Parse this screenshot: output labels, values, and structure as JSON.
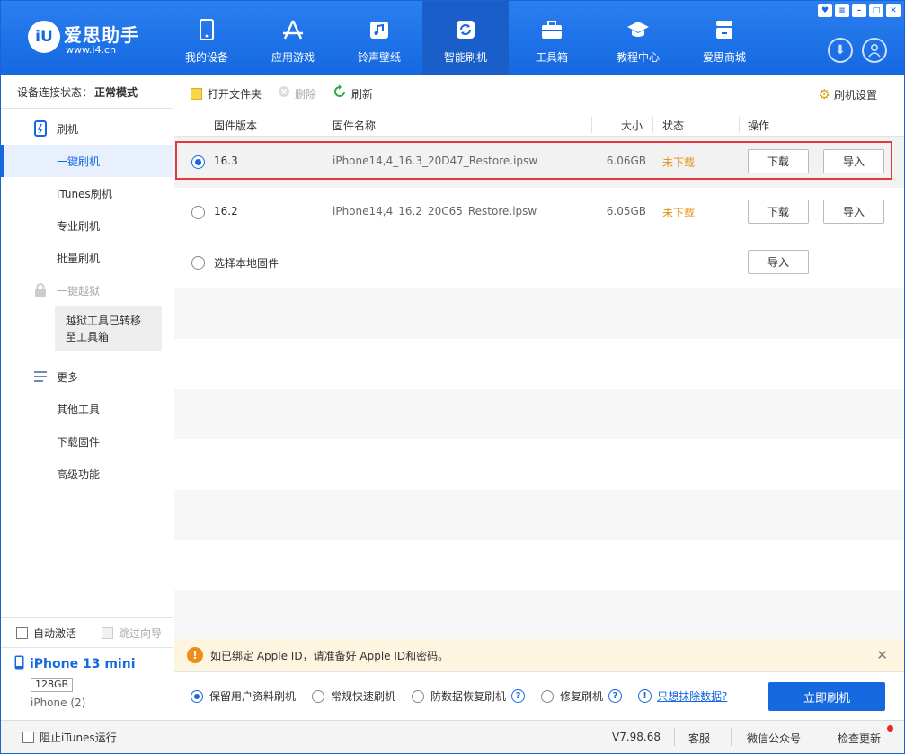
{
  "app": {
    "brand_name": "爱思助手",
    "brand_url": "www.i4.cn",
    "logo_text": "iU"
  },
  "nav": [
    {
      "label": "我的设备",
      "icon": "phone-icon"
    },
    {
      "label": "应用游戏",
      "icon": "app-store-icon"
    },
    {
      "label": "铃声壁纸",
      "icon": "music-icon"
    },
    {
      "label": "智能刷机",
      "icon": "refresh-icon",
      "active": true
    },
    {
      "label": "工具箱",
      "icon": "toolbox-icon"
    },
    {
      "label": "教程中心",
      "icon": "graduation-cap-icon"
    },
    {
      "label": "爱思商城",
      "icon": "store-icon"
    }
  ],
  "sidebar": {
    "conn_label": "设备连接状态：",
    "conn_value": "正常模式",
    "flash_section": "刷机",
    "flash_items": [
      "一键刷机",
      "iTunes刷机",
      "专业刷机",
      "批量刷机"
    ],
    "jailbreak_section": "一键越狱",
    "jailbreak_notice": "越狱工具已转移至工具箱",
    "more_section": "更多",
    "more_items": [
      "其他工具",
      "下载固件",
      "高级功能"
    ],
    "auto_activate": "自动激活",
    "skip_guide": "跳过向导",
    "device_name": "iPhone 13 mini",
    "device_capacity": "128GB",
    "device_type": "iPhone (2)"
  },
  "toolbar": {
    "open_folder": "打开文件夹",
    "delete": "删除",
    "refresh": "刷新",
    "settings": "刷机设置"
  },
  "table": {
    "columns": [
      "固件版本",
      "固件名称",
      "大小",
      "状态",
      "操作"
    ],
    "rows": [
      {
        "version": "16.3",
        "name": "iPhone14,4_16.3_20D47_Restore.ipsw",
        "size": "6.06GB",
        "status": "未下载",
        "download": "下载",
        "import": "导入",
        "selected": true
      },
      {
        "version": "16.2",
        "name": "iPhone14,4_16.2_20C65_Restore.ipsw",
        "size": "6.05GB",
        "status": "未下载",
        "download": "下载",
        "import": "导入",
        "selected": false
      }
    ],
    "local_label": "选择本地固件",
    "local_import": "导入"
  },
  "alert": {
    "text": "如已绑定 Apple ID，请准备好 Apple ID和密码。"
  },
  "options": {
    "keep_data": "保留用户资料刷机",
    "quick": "常规快速刷机",
    "anti_recovery": "防数据恢复刷机",
    "repair": "修复刷机",
    "erase_link": "只想抹除数据?",
    "flash_now": "立即刷机"
  },
  "footer": {
    "block_itunes": "阻止iTunes运行",
    "version": "V7.98.68",
    "service": "客服",
    "wechat": "微信公众号",
    "check_update": "检查更新"
  }
}
